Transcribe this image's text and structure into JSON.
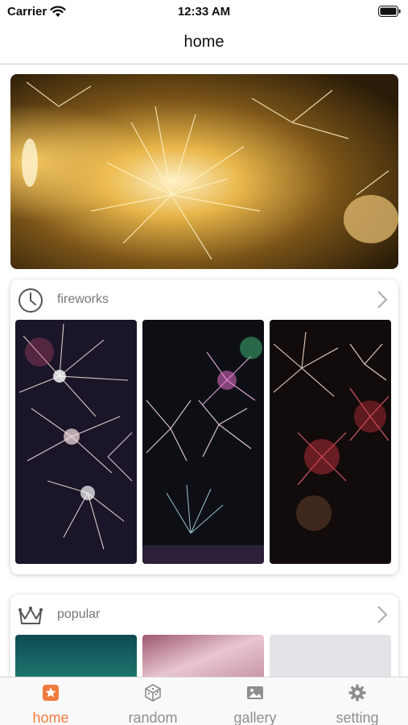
{
  "status_bar": {
    "carrier": "Carrier",
    "time": "12:33 AM"
  },
  "nav": {
    "title": "home"
  },
  "sections": [
    {
      "title": "fireworks",
      "icon": "clock-icon"
    },
    {
      "title": "popular",
      "icon": "crown-icon"
    }
  ],
  "tabs": [
    {
      "label": "home",
      "icon": "home-star-icon",
      "active": true
    },
    {
      "label": "random",
      "icon": "dice-icon",
      "active": false
    },
    {
      "label": "gallery",
      "icon": "photo-icon",
      "active": false
    },
    {
      "label": "setting",
      "icon": "gear-icon",
      "active": false
    }
  ],
  "colors": {
    "accent": "#f07b3f",
    "inactive": "#8e8e8e"
  }
}
